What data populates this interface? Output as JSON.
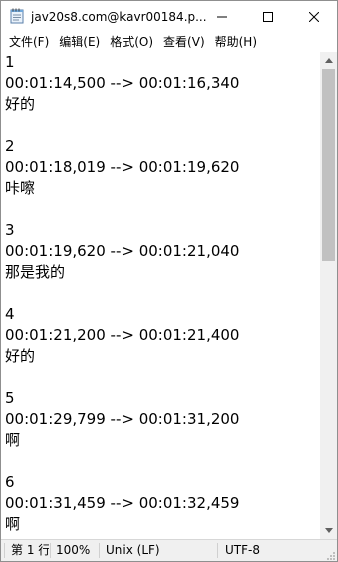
{
  "window": {
    "title": "jav20s8.com@kavr00184.p...",
    "icon": "notepad-icon"
  },
  "menu": [
    "文件(F)",
    "编辑(E)",
    "格式(O)",
    "查看(V)",
    "帮助(H)"
  ],
  "lines": [
    "1",
    "00:01:14,500 --> 00:01:16,340",
    "好的",
    "",
    "2",
    "00:01:18,019 --> 00:01:19,620",
    "咔嚓",
    "",
    "3",
    "00:01:19,620 --> 00:01:21,040",
    "那是我的",
    "",
    "4",
    "00:01:21,200 --> 00:01:21,400",
    "好的",
    "",
    "5",
    "00:01:29,799 --> 00:01:31,200",
    "啊",
    "",
    "6",
    "00:01:31,459 --> 00:01:32,459",
    "啊"
  ],
  "status": {
    "position": "第 1 行",
    "zoom": "100%",
    "line_ending": "Unix (LF)",
    "encoding": "UTF-8"
  }
}
